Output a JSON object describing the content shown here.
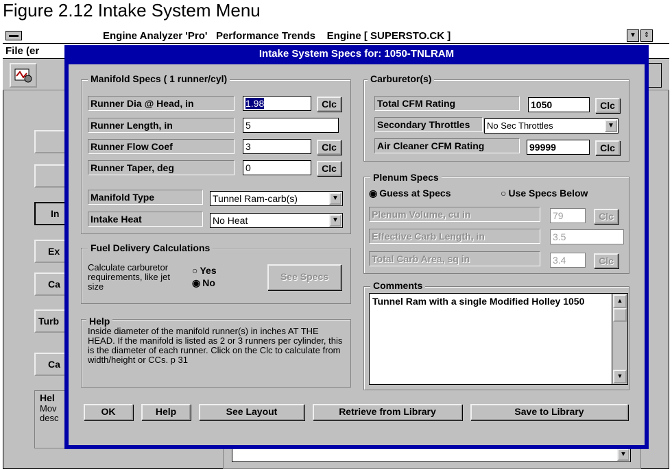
{
  "caption": "Figure 2.12 Intake System Menu",
  "background_window": {
    "title": "Engine Analyzer 'Pro'   Performance Trends    Engine [ SUPERSTO.CK ]",
    "menu_file": "File (er",
    "left_buttons": [
      "",
      "",
      "In",
      "Ex",
      "Ca",
      "Turb",
      "Ca"
    ],
    "help_title": "Hel",
    "help_text_1": "Mov",
    "help_text_2": "desc"
  },
  "dialog": {
    "title": "Intake System Specs for: 1050-TNLRAM",
    "manifold": {
      "group_title": "Manifold Specs ( 1 runner/cyl)",
      "runner_dia_label": "Runner Dia @ Head, in",
      "runner_dia_value": "1.98",
      "runner_length_label": "Runner Length, in",
      "runner_length_value": "5",
      "runner_flow_label": "Runner Flow Coef",
      "runner_flow_value": "3",
      "runner_taper_label": "Runner Taper, deg",
      "runner_taper_value": "0",
      "manifold_type_label": "Manifold Type",
      "manifold_type_value": "Tunnel Ram-carb(s)",
      "intake_heat_label": "Intake Heat",
      "intake_heat_value": "No Heat",
      "clc_label": "Clc"
    },
    "fuel": {
      "group_title": "Fuel Delivery Calculations",
      "description": "Calculate carburetor requirements, like jet size",
      "yes_label": "Yes",
      "no_label": "No",
      "see_specs_label": "See Specs"
    },
    "help": {
      "title": "Help",
      "text": "Inside diameter of the manifold runner(s) in inches AT THE HEAD.  If the manifold is listed as 2 or 3 runners per cylinder, this is the diameter of each runner.  Click on the Clc to calculate from width/height or CCs.  p 31"
    },
    "carburetor": {
      "group_title": "Carburetor(s)",
      "total_cfm_label": "Total CFM Rating",
      "total_cfm_value": "1050",
      "secondary_label": "Secondary Throttles",
      "secondary_value": "No Sec Throttles",
      "air_cleaner_label": "Air Cleaner CFM Rating",
      "air_cleaner_value": "99999"
    },
    "plenum": {
      "group_title": "Plenum Specs",
      "guess_label": "Guess at Specs",
      "use_specs_label": "Use Specs Below",
      "volume_label": "Plenum Volume, cu in",
      "volume_value": "79",
      "carb_length_label": "Effective Carb Length, in",
      "carb_length_value": "3.5",
      "carb_area_label": "Total Carb Area, sq in",
      "carb_area_value": "3.4"
    },
    "comments": {
      "group_title": "Comments",
      "text": "Tunnel Ram with a single Modified Holley 1050"
    },
    "buttons": {
      "ok": "OK",
      "help": "Help",
      "see_layout": "See Layout",
      "retrieve": "Retrieve from Library",
      "save": "Save to Library"
    }
  },
  "colors": {
    "dialog_frame": "#0000a8",
    "selection": "#000080",
    "face": "#c0c0c0"
  }
}
